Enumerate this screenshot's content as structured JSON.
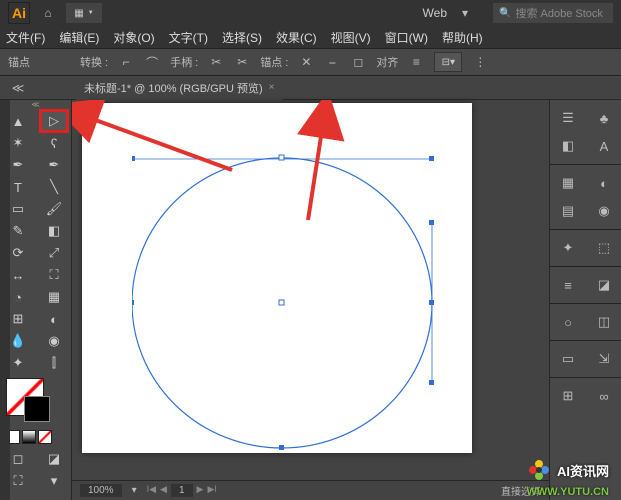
{
  "app": {
    "logo": "Ai",
    "workspace_preset": "Web",
    "search_placeholder": "搜索 Adobe Stock"
  },
  "menu": {
    "file": "文件(F)",
    "edit": "编辑(E)",
    "object": "对象(O)",
    "type": "文字(T)",
    "select": "选择(S)",
    "effect": "效果(C)",
    "view": "视图(V)",
    "window": "窗口(W)",
    "help": "帮助(H)"
  },
  "controlbar": {
    "anchor_label": "锚点",
    "convert_label": "转换 :",
    "handle_label": "手柄 :",
    "anchor2_label": "锚点 :",
    "align_label": "对齐"
  },
  "tab": {
    "title": "未标题-1* @ 100% (RGB/GPU 预览)",
    "close": "×"
  },
  "status": {
    "zoom": "100%",
    "page": "1",
    "tool": "直接选择"
  },
  "watermarks": {
    "w1": "AI资讯网",
    "w2": "WWW.YUTU.CN"
  },
  "colors": {
    "accent": "#ff9a00",
    "highlight": "#d22",
    "path": "#2e6fd6",
    "arrow": "#e2332c"
  }
}
